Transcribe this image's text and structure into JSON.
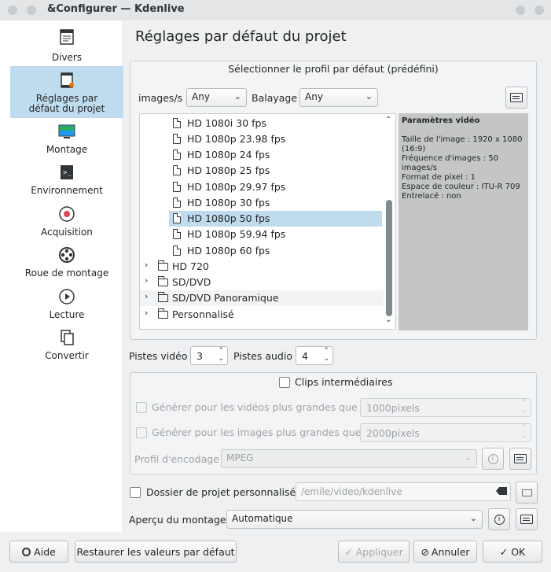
{
  "window": {
    "title": "&Configurer — Kdenlive"
  },
  "sidebar": {
    "items": [
      {
        "label": "Divers",
        "icon": "misc-icon"
      },
      {
        "label": "Réglages par\ndéfaut du projet",
        "icon": "project-defaults-icon",
        "selected": true
      },
      {
        "label": "Montage",
        "icon": "timeline-icon"
      },
      {
        "label": "Environnement",
        "icon": "terminal-icon"
      },
      {
        "label": "Acquisition",
        "icon": "record-icon"
      },
      {
        "label": "Roue de montage",
        "icon": "jog-wheel-icon"
      },
      {
        "label": "Lecture",
        "icon": "play-icon"
      },
      {
        "label": "Convertir",
        "icon": "convert-icon"
      }
    ]
  },
  "page": {
    "title": "Réglages par défaut du projet"
  },
  "profile": {
    "group_title": "Sélectionner le profil par défaut (prédéfini)",
    "fps_label": "images/s",
    "fps_value": "Any",
    "scan_label": "Balayage",
    "scan_value": "Any",
    "tree": [
      {
        "label": "HD 1080i 30 fps",
        "type": "file"
      },
      {
        "label": "HD 1080p 23.98 fps",
        "type": "file"
      },
      {
        "label": "HD 1080p 24 fps",
        "type": "file"
      },
      {
        "label": "HD 1080p 25 fps",
        "type": "file"
      },
      {
        "label": "HD 1080p 29.97 fps",
        "type": "file"
      },
      {
        "label": "HD 1080p 30 fps",
        "type": "file"
      },
      {
        "label": "HD 1080p 50 fps",
        "type": "file",
        "selected": true
      },
      {
        "label": "HD 1080p 59.94 fps",
        "type": "file"
      },
      {
        "label": "HD 1080p 60 fps",
        "type": "file"
      },
      {
        "label": "HD 720",
        "type": "folder"
      },
      {
        "label": "SD/DVD",
        "type": "folder"
      },
      {
        "label": "SD/DVD Panoramique",
        "type": "folder"
      },
      {
        "label": "Personnalisé",
        "type": "folder"
      }
    ],
    "info": {
      "heading": "Paramètres vidéo",
      "frame_size": "Taille de l'image : 1920 x 1080 (16:9)",
      "frame_rate": "Fréquence d'images : 50 images/s",
      "pixel_aspect": "Format de pixel : 1",
      "colorspace": "Espace de couleur : ITU-R 709",
      "interlaced": "Entrelacé : non"
    }
  },
  "tracks": {
    "video_label": "Pistes vidéo",
    "video_value": "3",
    "audio_label": "Pistes audio",
    "audio_value": "4"
  },
  "proxy": {
    "enable_label": "Clips intermédiaires",
    "videos_label": "Générer pour les vidéos plus grandes que",
    "videos_value": "1000pixels",
    "images_label": "Générer pour les images plus grandes que",
    "images_value": "2000pixels",
    "encoding_label": "Profil d'encodage",
    "encoding_value": "MPEG"
  },
  "custom_folder": {
    "label": "Dossier de projet personnalisé",
    "path": "/emile/video/kdenlive"
  },
  "preview": {
    "label": "Aperçu du montage",
    "value": "Automatique"
  },
  "buttons": {
    "help": "Aide",
    "restore": "Restaurer les valeurs par défaut",
    "apply": "Appliquer",
    "cancel": "Annuler",
    "ok": "OK"
  }
}
